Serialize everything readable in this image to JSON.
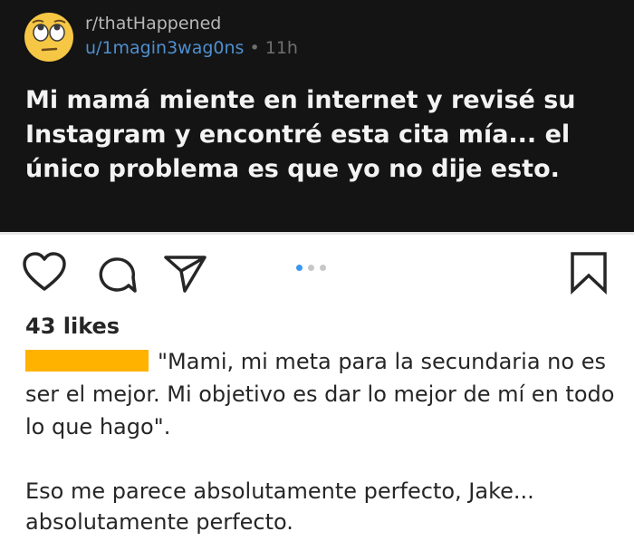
{
  "reddit_post": {
    "subreddit": "r/thatHappened",
    "username": "u/1magin3wag0ns",
    "separator": "•",
    "age": "11h",
    "avatar_icon": "rolling-eyes-emoji",
    "title": "Mi mamá miente en internet y revisé su Instagram y encontré esta cita mía... el único problema es que yo no dije esto."
  },
  "instagram_post": {
    "action_icons": [
      "heart-icon",
      "comment-icon",
      "share-icon",
      "bookmark-icon"
    ],
    "carousel": {
      "total": 3,
      "active": 1
    },
    "likes": "43 likes",
    "caption_text": "\"Mami, mi meta para la secundaria no es ser el mejor. Mi objetivo es dar lo mejor de mí en todo lo que hago\".",
    "comment_text": "Eso me parece absolutamente perfecto, Jake... absolutamente perfecto."
  },
  "colors": {
    "reddit_background": "#141414",
    "username_blue": "#4f8fd0",
    "redaction_orange": "#ffb300",
    "carousel_active_dot": "#3897f0"
  }
}
